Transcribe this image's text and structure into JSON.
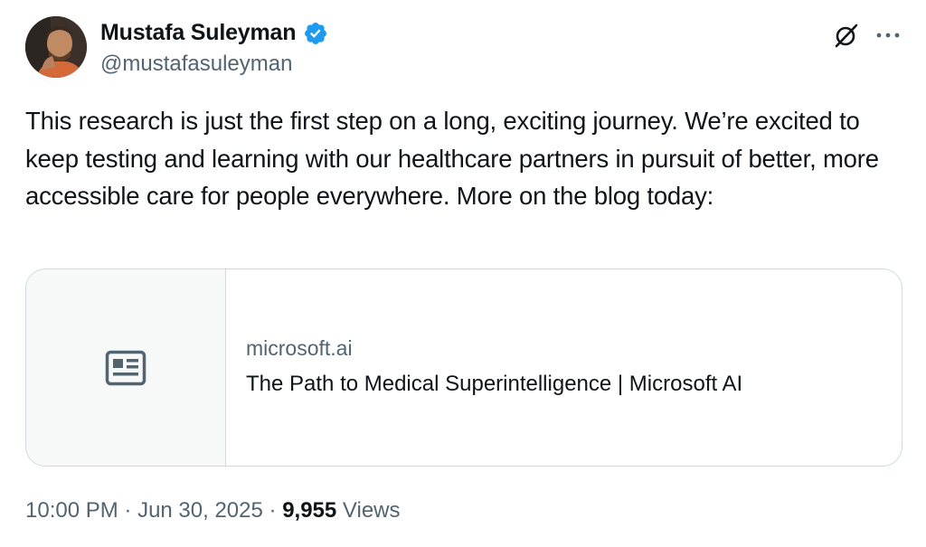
{
  "author": {
    "name": "Mustafa Suleyman",
    "handle": "@mustafasuleyman",
    "verified": true
  },
  "tweet": {
    "text": "This research is just the first step on a long, exciting journey. We’re excited to keep testing and learning with our healthcare partners in pursuit of better, more accessible care for people everywhere. More on the blog today:"
  },
  "link_card": {
    "domain": "microsoft.ai",
    "title": "The Path to Medical Superintelligence  | Microsoft AI",
    "thumbnail_icon": "news-article-icon"
  },
  "meta": {
    "time": "10:00 PM",
    "separator": " · ",
    "date": "Jun 30, 2025",
    "views_count": "9,955",
    "views_label": "Views"
  },
  "icons": {
    "grok": "grok-icon",
    "more": "more-options-icon",
    "verified": "verified-badge-icon"
  },
  "colors": {
    "text_primary": "#0f1419",
    "text_secondary": "#536471",
    "verified_blue": "#1d9bf0",
    "border": "#cfd9de",
    "card_thumb_bg": "#f7f9f9"
  }
}
